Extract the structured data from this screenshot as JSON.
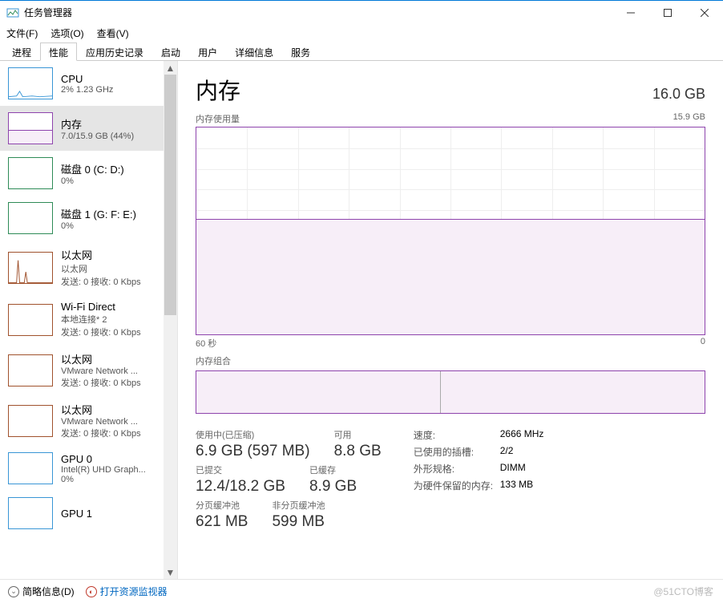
{
  "window": {
    "title": "任务管理器"
  },
  "menu": {
    "file": "文件(F)",
    "options": "选项(O)",
    "view": "查看(V)"
  },
  "tabs": [
    {
      "label": "进程"
    },
    {
      "label": "性能"
    },
    {
      "label": "应用历史记录"
    },
    {
      "label": "启动"
    },
    {
      "label": "用户"
    },
    {
      "label": "详细信息"
    },
    {
      "label": "服务"
    }
  ],
  "active_tab": 1,
  "sidebar": [
    {
      "name": "CPU",
      "l2": "2%  1.23 GHz",
      "l3": "",
      "color": "#3996d6",
      "fill": "#e8f2fb",
      "shape": "cpu"
    },
    {
      "name": "内存",
      "l2": "7.0/15.9 GB (44%)",
      "l3": "",
      "color": "#8e44ad",
      "fill": "#f7eef8",
      "shape": "mem",
      "selected": true
    },
    {
      "name": "磁盘 0 (C: D:)",
      "l2": "0%",
      "l3": "",
      "color": "#2e8b57",
      "fill": "#fff",
      "shape": "flat"
    },
    {
      "name": "磁盘 1 (G: F: E:)",
      "l2": "0%",
      "l3": "",
      "color": "#2e8b57",
      "fill": "#fff",
      "shape": "flat"
    },
    {
      "name": "以太网",
      "l2": "以太网",
      "l3": "发送: 0 接收: 0 Kbps",
      "color": "#a0522d",
      "fill": "#fff",
      "shape": "net"
    },
    {
      "name": "Wi-Fi Direct",
      "l2": "本地连接* 2",
      "l3": "发送: 0 接收: 0 Kbps",
      "color": "#a0522d",
      "fill": "#fff",
      "shape": "flat"
    },
    {
      "name": "以太网",
      "l2": "VMware Network ...",
      "l3": "发送: 0 接收: 0 Kbps",
      "color": "#a0522d",
      "fill": "#fff",
      "shape": "flat"
    },
    {
      "name": "以太网",
      "l2": "VMware Network ...",
      "l3": "发送: 0 接收: 0 Kbps",
      "color": "#a0522d",
      "fill": "#fff",
      "shape": "flat"
    },
    {
      "name": "GPU 0",
      "l2": "Intel(R) UHD Graph...",
      "l3": "0%",
      "color": "#3996d6",
      "fill": "#fff",
      "shape": "flat"
    },
    {
      "name": "GPU 1",
      "l2": "",
      "l3": "",
      "color": "#3996d6",
      "fill": "#fff",
      "shape": "flat"
    }
  ],
  "main": {
    "title": "内存",
    "capacity": "16.0 GB",
    "usage_label": "内存使用量",
    "usage_max": "15.9 GB",
    "x_left": "60 秒",
    "x_right": "0",
    "comp_label": "内存组合"
  },
  "stats": {
    "in_use_label": "使用中(已压缩)",
    "in_use": "6.9 GB (597 MB)",
    "avail_label": "可用",
    "avail": "8.8 GB",
    "commit_label": "已提交",
    "commit": "12.4/18.2 GB",
    "cached_label": "已缓存",
    "cached": "8.9 GB",
    "paged_label": "分页缓冲池",
    "paged": "621 MB",
    "nonpaged_label": "非分页缓冲池",
    "nonpaged": "599 MB",
    "speed_label": "速度:",
    "speed": "2666 MHz",
    "slots_label": "已使用的插槽:",
    "slots": "2/2",
    "form_label": "外形规格:",
    "form": "DIMM",
    "reserved_label": "为硬件保留的内存:",
    "reserved": "133 MB"
  },
  "footer": {
    "brief": "简略信息(D)",
    "resmon": "打开资源监视器"
  },
  "watermark": "@51CTO博客",
  "chart_data": {
    "type": "area",
    "title": "内存使用量",
    "x": [
      60,
      0
    ],
    "xlabel": "秒",
    "y_percent": 44,
    "ylim": [
      0,
      15.9
    ],
    "ylabel": "GB",
    "series": [
      {
        "name": "内存",
        "values_gb_approx": 7.0,
        "flat": true
      }
    ]
  }
}
